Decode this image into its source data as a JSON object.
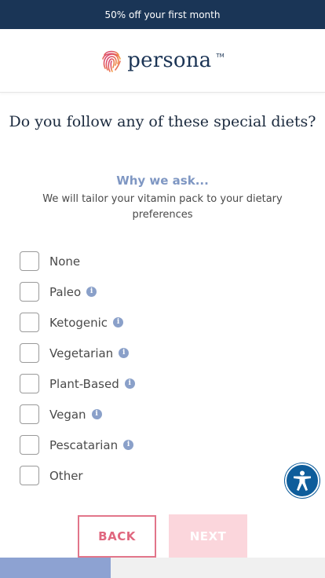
{
  "promo": {
    "text": "50% off your first month"
  },
  "header": {
    "logo_text": "persona",
    "logo_mark": "TM"
  },
  "question": {
    "title": "Do you follow any of these special diets?"
  },
  "why": {
    "title": "Why we ask...",
    "text": "We will tailor your vitamin pack to your dietary preferences"
  },
  "options": [
    {
      "label": "None",
      "info": false,
      "checked": false
    },
    {
      "label": "Paleo",
      "info": true,
      "checked": false
    },
    {
      "label": "Ketogenic",
      "info": true,
      "checked": false
    },
    {
      "label": "Vegetarian",
      "info": true,
      "checked": false
    },
    {
      "label": "Plant-Based",
      "info": true,
      "checked": false
    },
    {
      "label": "Vegan",
      "info": true,
      "checked": false
    },
    {
      "label": "Pescatarian",
      "info": true,
      "checked": false
    },
    {
      "label": "Other",
      "info": false,
      "checked": false
    }
  ],
  "icons": {
    "info": "info-icon",
    "accessibility": "accessibility-icon",
    "logo": "fingerprint-logo-icon"
  },
  "buttons": {
    "back": "BACK",
    "next": "NEXT"
  },
  "progress": {
    "fraction": 0.34
  },
  "colors": {
    "promo_bg": "#1a3556",
    "accent_blue": "#8aa0c9",
    "back_border": "#e2758a",
    "next_disabled_bg": "#fbd6dc",
    "a11y_blue": "#0e5d9b",
    "progress_fill": "#8da2d2"
  }
}
